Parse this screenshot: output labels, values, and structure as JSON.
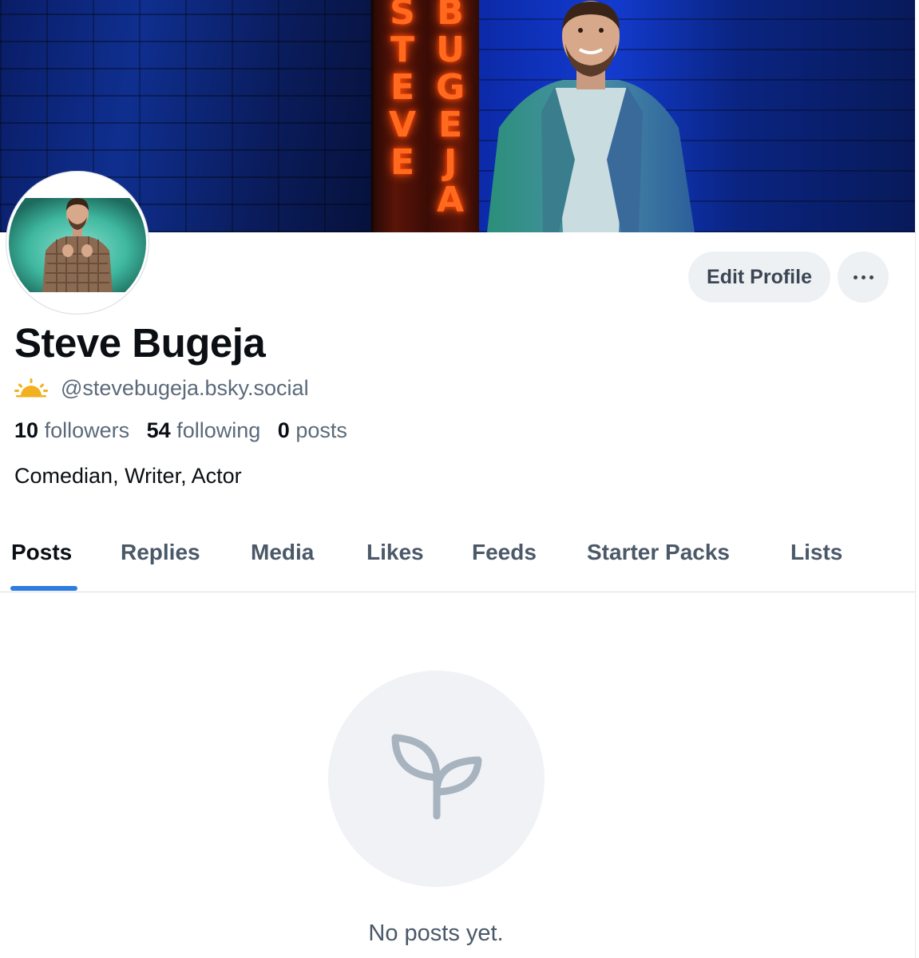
{
  "profile": {
    "display_name": "Steve Bugeja",
    "handle": "@stevebugeja.bsky.social",
    "bio": "Comedian, Writer, Actor",
    "stats": {
      "followers_count": "10",
      "followers_label": "followers",
      "following_count": "54",
      "following_label": "following",
      "posts_count": "0",
      "posts_label": "posts"
    },
    "banner_sign_letters_left": [
      "S",
      "T",
      "E",
      "V",
      "E"
    ],
    "banner_sign_letters_right": [
      "B",
      "U",
      "G",
      "E",
      "J",
      "A"
    ]
  },
  "actions": {
    "edit_profile_label": "Edit Profile",
    "more_icon": "ellipsis-icon"
  },
  "tabs": [
    {
      "label": "Posts",
      "active": true
    },
    {
      "label": "Replies",
      "active": false
    },
    {
      "label": "Media",
      "active": false
    },
    {
      "label": "Likes",
      "active": false
    },
    {
      "label": "Feeds",
      "active": false
    },
    {
      "label": "Starter Packs",
      "active": false
    },
    {
      "label": "Lists",
      "active": false
    }
  ],
  "empty_state": {
    "icon": "sprout-icon",
    "message": "No posts yet."
  },
  "colors": {
    "accent": "#2f7ce0",
    "button_bg": "#eef1f4",
    "muted_text": "#5b6a7a",
    "sun_icon": "#f2b01e"
  }
}
